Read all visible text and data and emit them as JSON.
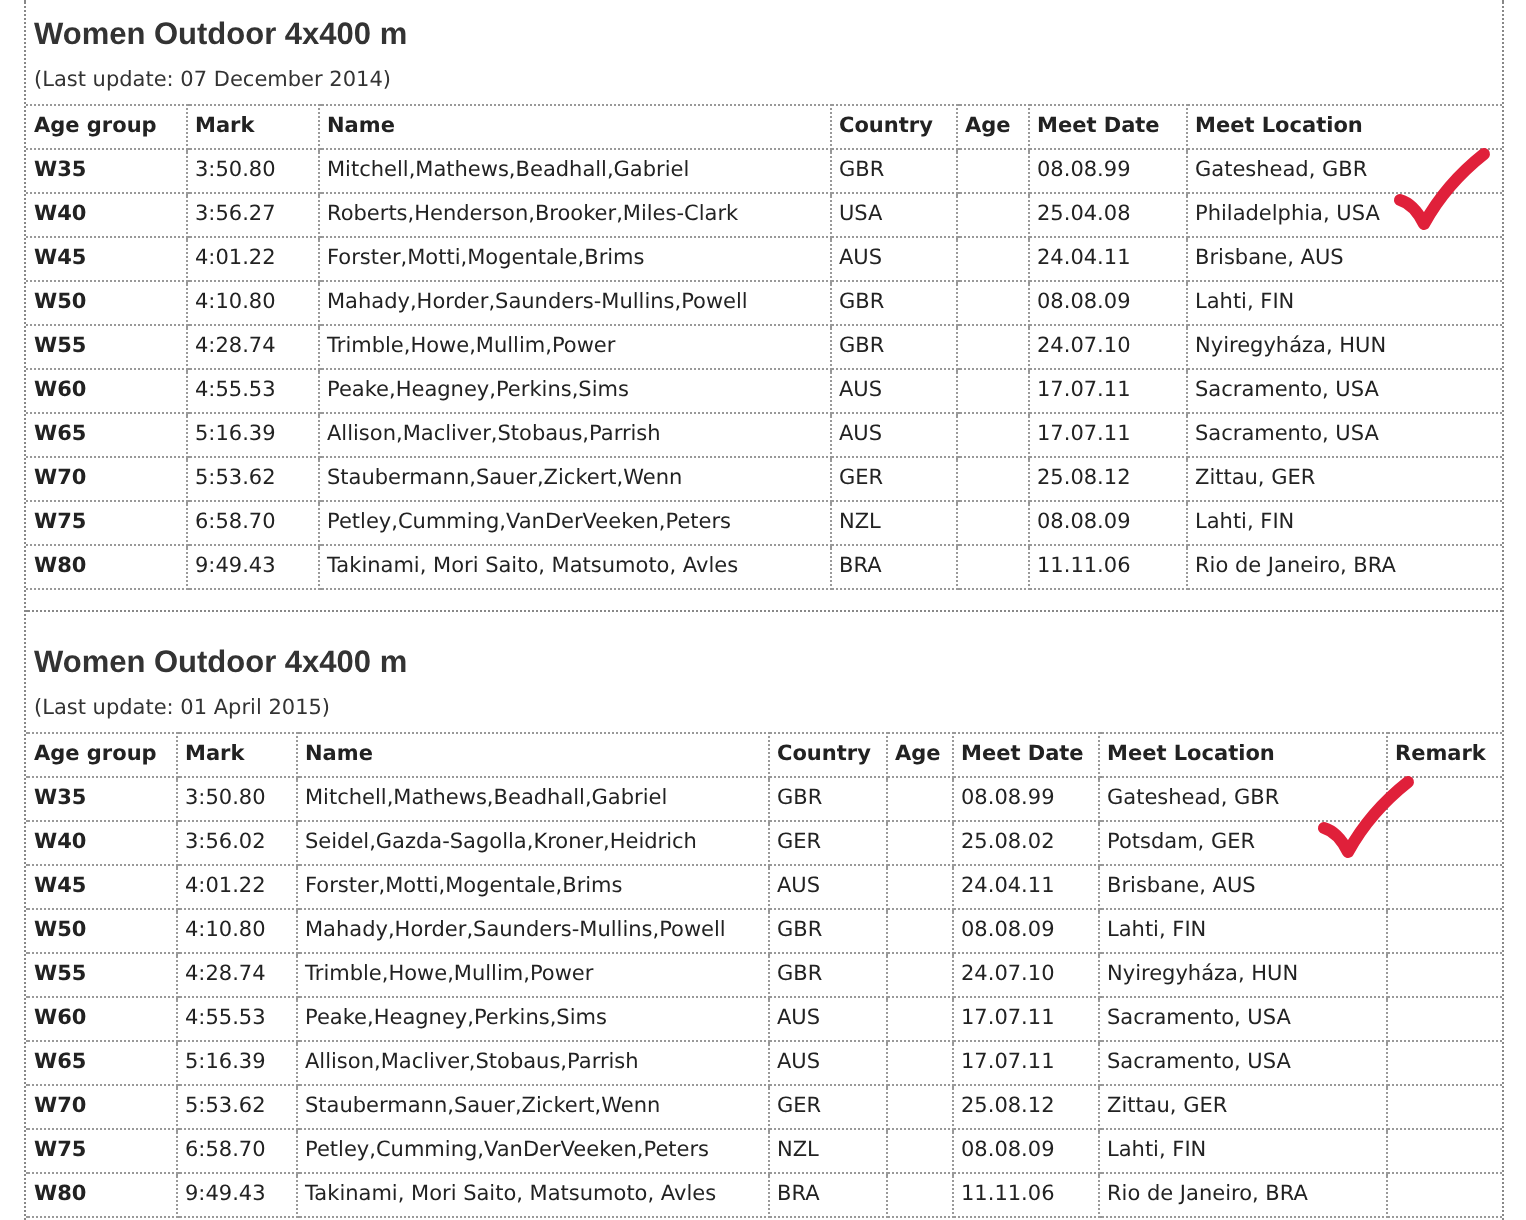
{
  "sections": [
    {
      "title": "Women Outdoor 4x400 m",
      "last_update": "(Last update: 07 December 2014)",
      "columns": [
        "Age group",
        "Mark",
        "Name",
        "Country",
        "Age",
        "Meet Date",
        "Meet Location"
      ],
      "rows": [
        {
          "age_group": "W35",
          "mark": "3:50.80",
          "name": "Mitchell,Mathews,Beadhall,Gabriel",
          "country": "GBR",
          "meet_date": "08.08.99",
          "meet_location": "Gateshead, GBR",
          "marked": false
        },
        {
          "age_group": "W40",
          "mark": "3:56.27",
          "name": "Roberts,Henderson,Brooker,Miles-Clark",
          "country": "USA",
          "meet_date": "25.04.08",
          "meet_location": "Philadelphia, USA",
          "marked": true
        },
        {
          "age_group": "W45",
          "mark": "4:01.22",
          "name": "Forster,Motti,Mogentale,Brims",
          "country": "AUS",
          "meet_date": "24.04.11",
          "meet_location": "Brisbane, AUS",
          "marked": false
        },
        {
          "age_group": "W50",
          "mark": "4:10.80",
          "name": "Mahady,Horder,Saunders-Mullins,Powell",
          "country": "GBR",
          "meet_date": "08.08.09",
          "meet_location": "Lahti, FIN",
          "marked": false
        },
        {
          "age_group": "W55",
          "mark": "4:28.74",
          "name": "Trimble,Howe,Mullim,Power",
          "country": "GBR",
          "meet_date": "24.07.10",
          "meet_location": "Nyiregyháza, HUN",
          "marked": false
        },
        {
          "age_group": "W60",
          "mark": "4:55.53",
          "name": "Peake,Heagney,Perkins,Sims",
          "country": "AUS",
          "meet_date": "17.07.11",
          "meet_location": "Sacramento, USA",
          "marked": false
        },
        {
          "age_group": "W65",
          "mark": "5:16.39",
          "name": "Allison,Macliver,Stobaus,Parrish",
          "country": "AUS",
          "meet_date": "17.07.11",
          "meet_location": "Sacramento, USA",
          "marked": false
        },
        {
          "age_group": "W70",
          "mark": "5:53.62",
          "name": "Staubermann,Sauer,Zickert,Wenn",
          "country": "GER",
          "meet_date": "25.08.12",
          "meet_location": "Zittau, GER",
          "marked": false
        },
        {
          "age_group": "W75",
          "mark": "6:58.70",
          "name": "Petley,Cumming,VanDerVeeken,Peters",
          "country": "NZL",
          "meet_date": "08.08.09",
          "meet_location": "Lahti, FIN",
          "marked": false
        },
        {
          "age_group": "W80",
          "mark": "9:49.43",
          "name": "Takinami, Mori Saito, Matsumoto, Avles",
          "country": "BRA",
          "meet_date": "11.11.06",
          "meet_location": "Rio de Janeiro, BRA",
          "marked": false
        }
      ]
    },
    {
      "title": "Women Outdoor 4x400 m",
      "last_update": "(Last update: 01 April 2015)",
      "columns": [
        "Age group",
        "Mark",
        "Name",
        "Country",
        "Age",
        "Meet Date",
        "Meet Location",
        "Remark"
      ],
      "rows": [
        {
          "age_group": "W35",
          "mark": "3:50.80",
          "name": "Mitchell,Mathews,Beadhall,Gabriel",
          "country": "GBR",
          "meet_date": "08.08.99",
          "meet_location": "Gateshead, GBR",
          "marked": false
        },
        {
          "age_group": "W40",
          "mark": "3:56.02",
          "name": "Seidel,Gazda-Sagolla,Kroner,Heidrich",
          "country": "GER",
          "meet_date": "25.08.02",
          "meet_location": "Potsdam, GER",
          "marked": true
        },
        {
          "age_group": "W45",
          "mark": "4:01.22",
          "name": "Forster,Motti,Mogentale,Brims",
          "country": "AUS",
          "meet_date": "24.04.11",
          "meet_location": "Brisbane, AUS",
          "marked": false
        },
        {
          "age_group": "W50",
          "mark": "4:10.80",
          "name": "Mahady,Horder,Saunders-Mullins,Powell",
          "country": "GBR",
          "meet_date": "08.08.09",
          "meet_location": "Lahti, FIN",
          "marked": false
        },
        {
          "age_group": "W55",
          "mark": "4:28.74",
          "name": "Trimble,Howe,Mullim,Power",
          "country": "GBR",
          "meet_date": "24.07.10",
          "meet_location": "Nyiregyháza, HUN",
          "marked": false
        },
        {
          "age_group": "W60",
          "mark": "4:55.53",
          "name": "Peake,Heagney,Perkins,Sims",
          "country": "AUS",
          "meet_date": "17.07.11",
          "meet_location": "Sacramento, USA",
          "marked": false
        },
        {
          "age_group": "W65",
          "mark": "5:16.39",
          "name": "Allison,Macliver,Stobaus,Parrish",
          "country": "AUS",
          "meet_date": "17.07.11",
          "meet_location": "Sacramento, USA",
          "marked": false
        },
        {
          "age_group": "W70",
          "mark": "5:53.62",
          "name": "Staubermann,Sauer,Zickert,Wenn",
          "country": "GER",
          "meet_date": "25.08.12",
          "meet_location": "Zittau, GER",
          "marked": false
        },
        {
          "age_group": "W75",
          "mark": "6:58.70",
          "name": "Petley,Cumming,VanDerVeeken,Peters",
          "country": "NZL",
          "meet_date": "08.08.09",
          "meet_location": "Lahti, FIN",
          "marked": false
        },
        {
          "age_group": "W80",
          "mark": "9:49.43",
          "name": "Takinami, Mori Saito, Matsumoto, Avles",
          "country": "BRA",
          "meet_date": "11.11.06",
          "meet_location": "Rio de Janeiro, BRA",
          "marked": false
        }
      ]
    }
  ]
}
